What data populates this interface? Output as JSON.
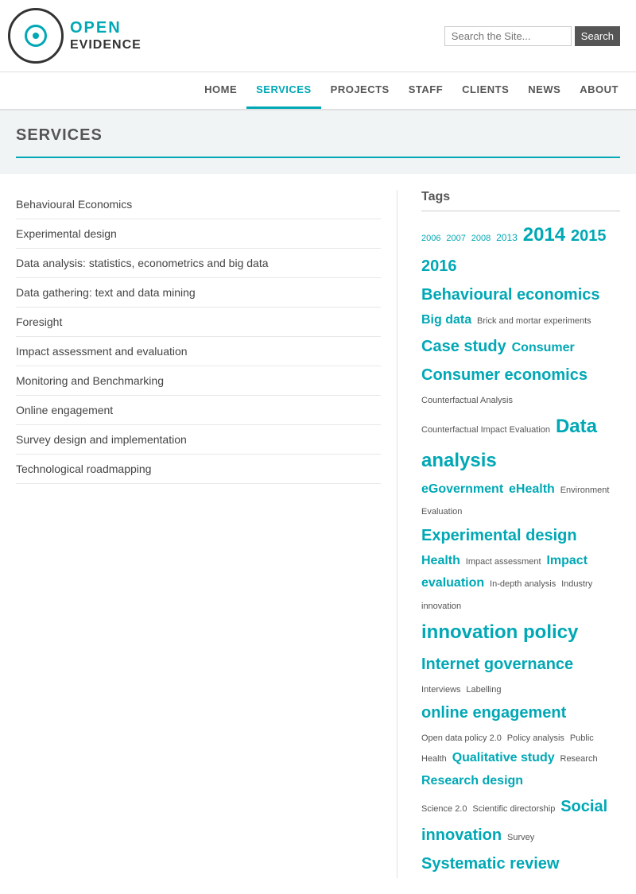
{
  "header": {
    "logo_open": "OPEN",
    "logo_evidence": "EVIDENCE",
    "search_placeholder": "Search the Site...",
    "search_button": "Search"
  },
  "nav": {
    "items": [
      {
        "label": "HOME",
        "active": false
      },
      {
        "label": "SERVICES",
        "active": true
      },
      {
        "label": "PROJECTS",
        "active": false
      },
      {
        "label": "STAFF",
        "active": false
      },
      {
        "label": "CLIENTS",
        "active": false
      },
      {
        "label": "NEWS",
        "active": false
      },
      {
        "label": "ABOUT",
        "active": false
      }
    ]
  },
  "page": {
    "title": "SERVICES"
  },
  "services": {
    "items": [
      "Behavioural Economics",
      "Experimental design",
      "Data analysis: statistics, econometrics and big data",
      "Data gathering: text and data mining",
      "Foresight",
      "Impact assessment and evaluation",
      "Monitoring and Benchmarking",
      "Online engagement",
      "Survey design and implementation",
      "Technological roadmapping"
    ]
  },
  "tags": {
    "title": "Tags",
    "items": [
      {
        "text": "2006",
        "size": "xsmall"
      },
      {
        "text": "2007",
        "size": "xsmall"
      },
      {
        "text": "2008",
        "size": "xsmall"
      },
      {
        "text": "2013",
        "size": "small"
      },
      {
        "text": "2014",
        "size": "large"
      },
      {
        "text": "2015",
        "size": "medium-large"
      },
      {
        "text": "2016",
        "size": "medium-large"
      },
      {
        "text": "Behavioural economics",
        "size": "medium-large"
      },
      {
        "text": "Big data",
        "size": "medium"
      },
      {
        "text": "Brick and mortar experiments",
        "size": "dark"
      },
      {
        "text": "Case study",
        "size": "medium-large"
      },
      {
        "text": "Consumer",
        "size": "medium"
      },
      {
        "text": "Consumer economics",
        "size": "medium-large"
      },
      {
        "text": "Counterfactual Analysis",
        "size": "dark"
      },
      {
        "text": "Counterfactual Impact Evaluation",
        "size": "dark"
      },
      {
        "text": "Data analysis",
        "size": "large"
      },
      {
        "text": "eGovernment",
        "size": "medium"
      },
      {
        "text": "eHealth",
        "size": "medium"
      },
      {
        "text": "Environment",
        "size": "dark"
      },
      {
        "text": "Evaluation",
        "size": "dark"
      },
      {
        "text": "Experimental design",
        "size": "medium-large"
      },
      {
        "text": "Health",
        "size": "medium"
      },
      {
        "text": "Impact assessment",
        "size": "dark"
      },
      {
        "text": "Impact evaluation",
        "size": "medium"
      },
      {
        "text": "In-depth analysis",
        "size": "dark"
      },
      {
        "text": "Industry innovation",
        "size": "dark"
      },
      {
        "text": "innovation policy",
        "size": "large"
      },
      {
        "text": "Internet governance",
        "size": "medium-large"
      },
      {
        "text": "Interviews",
        "size": "dark"
      },
      {
        "text": "Labelling",
        "size": "dark"
      },
      {
        "text": "online engagement",
        "size": "medium-large"
      },
      {
        "text": "Open data policy 2.0",
        "size": "dark"
      },
      {
        "text": "Policy analysis",
        "size": "dark"
      },
      {
        "text": "Public Health",
        "size": "dark"
      },
      {
        "text": "Qualitative study",
        "size": "medium"
      },
      {
        "text": "Research",
        "size": "dark"
      },
      {
        "text": "Research design",
        "size": "medium"
      },
      {
        "text": "Science 2.0",
        "size": "dark"
      },
      {
        "text": "Scientific directorship",
        "size": "dark"
      },
      {
        "text": "Social innovation",
        "size": "medium-large"
      },
      {
        "text": "Survey",
        "size": "dark"
      },
      {
        "text": "Systematic review",
        "size": "medium-large"
      }
    ]
  }
}
